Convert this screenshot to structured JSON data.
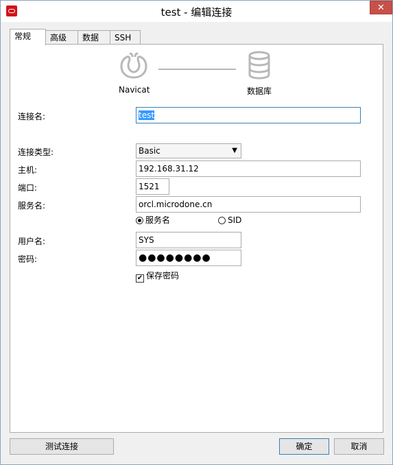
{
  "window": {
    "title": "test - 编辑连接",
    "close_glyph": "✕"
  },
  "tabs": [
    {
      "label": "常规",
      "active": true
    },
    {
      "label": "高级",
      "active": false
    },
    {
      "label": "数据库",
      "active": false
    },
    {
      "label": "SSH",
      "active": false
    }
  ],
  "diagram": {
    "left_label": "Navicat",
    "right_label": "数据库",
    "left_icon": "navicat-logo-icon",
    "right_icon": "database-icon"
  },
  "form": {
    "connection_name_label": "连接名:",
    "connection_name_value": "test",
    "connection_type_label": "连接类型:",
    "connection_type_value": "Basic",
    "host_label": "主机:",
    "host_value": "192.168.31.12",
    "port_label": "端口:",
    "port_value": "1521",
    "service_name_label": "服务名:",
    "service_name_value": "orcl.microdone.cn",
    "radio_service_name": "服务名",
    "radio_sid": "SID",
    "username_label": "用户名:",
    "username_value": "SYS",
    "password_label": "密码:",
    "password_value": "●●●●●●●●",
    "save_password_label": "保存密码",
    "check_glyph": "✔"
  },
  "buttons": {
    "test_connection": "测试连接",
    "ok": "确定",
    "cancel": "取消"
  },
  "colors": {
    "accent": "#3c7fb1",
    "selection": "#3399ff",
    "close": "#c7504a"
  }
}
